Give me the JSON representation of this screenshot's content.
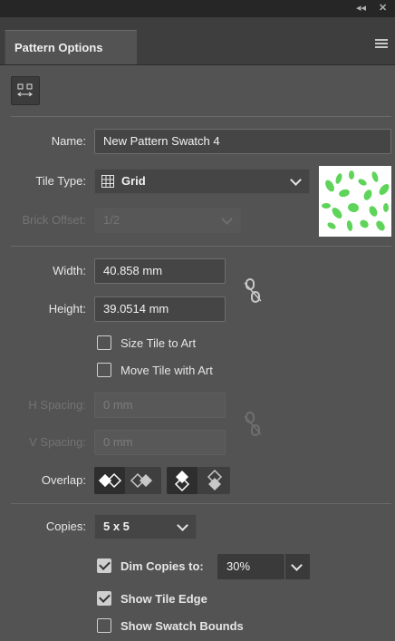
{
  "panel": {
    "title": "Pattern Options",
    "collapse_icon": "double-chevron-left-icon",
    "close_icon": "close-icon",
    "menu_icon": "hamburger-menu-icon"
  },
  "toolbar": {
    "tile_tool_icon": "pattern-tile-tool-icon"
  },
  "form": {
    "name_label": "Name:",
    "name_value": "New Pattern Swatch 4",
    "tile_type_label": "Tile Type:",
    "tile_type_value": "Grid",
    "tile_type_icon": "grid-icon",
    "brick_offset_label": "Brick Offset:",
    "brick_offset_value": "1/2",
    "width_label": "Width:",
    "width_value": "40.858 mm",
    "height_label": "Height:",
    "height_value": "39.0514 mm",
    "size_tile_label": "Size Tile to Art",
    "size_tile_checked": false,
    "move_tile_label": "Move Tile with Art",
    "move_tile_checked": false,
    "h_spacing_label": "H Spacing:",
    "h_spacing_value": "0 mm",
    "v_spacing_label": "V Spacing:",
    "v_spacing_value": "0 mm",
    "overlap_label": "Overlap:",
    "copies_label": "Copies:",
    "copies_value": "5 x 5",
    "dim_copies_label": "Dim Copies to:",
    "dim_copies_checked": true,
    "dim_copies_value": "30%",
    "show_tile_edge_label": "Show Tile Edge",
    "show_tile_edge_checked": true,
    "show_swatch_bounds_label": "Show Swatch Bounds",
    "show_swatch_bounds_checked": false
  },
  "colors": {
    "panel_bg": "#535353",
    "leaf_green": "#5fd45a"
  }
}
